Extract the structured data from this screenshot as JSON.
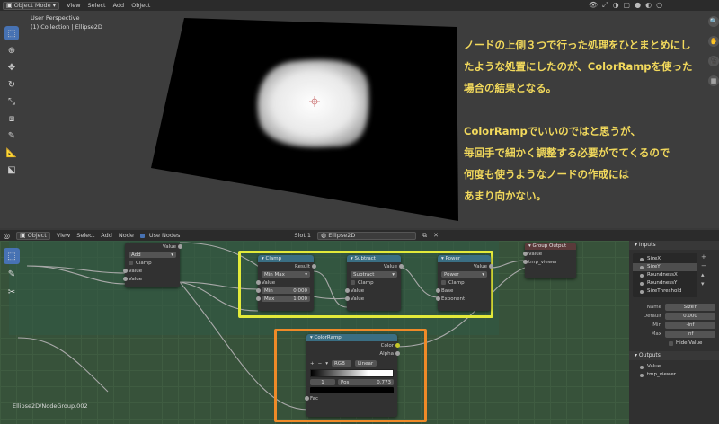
{
  "viewport": {
    "mode": "Object Mode",
    "menu": [
      "View",
      "Select",
      "Add",
      "Object"
    ],
    "perspective": "User Perspective",
    "collection": "(1) Collection | Ellipse2D"
  },
  "annotation": {
    "lines_top": [
      "ノードの上側３つで行った処理をひとまとめにし",
      "たような処置にしたのが、ColorRampを使った",
      "場合の結果となる。"
    ],
    "lines_bottom": [
      "ColorRampでいいのではと思うが、",
      "毎回手で細かく調整する必要がでてくるので",
      "何度も使うようなノードの作成には",
      "あまり向かない。"
    ]
  },
  "node_editor": {
    "type": "Object",
    "menu": [
      "View",
      "Select",
      "Add",
      "Node"
    ],
    "use_nodes": "Use Nodes",
    "slot": "Slot 1",
    "material": "Ellipse2D",
    "breadcrumb": "Ellipse2D/NodeGroup.002",
    "colors": {
      "highlight_yellow": "#e3ea3a",
      "highlight_orange": "#ef8a28",
      "node_header": "#3a6e83"
    }
  },
  "nodes": {
    "math_add": {
      "top_label": "Value",
      "op": "Add",
      "clamp": "Clamp",
      "in1": "Value",
      "in2": "Value"
    },
    "clamp": {
      "title": "Clamp",
      "out": "Result",
      "type": "Min Max",
      "value": "Value",
      "min_label": "Min",
      "min": "0.000",
      "max_label": "Max",
      "max": "1.000"
    },
    "subtract": {
      "title": "Subtract",
      "out": "Value",
      "op": "Subtract",
      "clamp": "Clamp",
      "in1": "Value",
      "in2": "Value"
    },
    "power": {
      "title": "Power",
      "out": "Value",
      "op": "Power",
      "clamp": "Clamp",
      "in1": "Base",
      "in2": "Exponent"
    },
    "group_output": {
      "title": "Group Output",
      "in1": "Value",
      "in2": "tmp_viewer"
    },
    "colorramp": {
      "title": "ColorRamp",
      "out1": "Color",
      "out2": "Alpha",
      "mode": "RGB",
      "interp": "Linear",
      "index": "1",
      "pos_label": "Pos",
      "pos": "0.773",
      "in": "Fac"
    }
  },
  "sidebar": {
    "inputs_title": "Inputs",
    "inputs": [
      "SizeX",
      "SizeY",
      "RoundnessX",
      "RoundnessY",
      "SizeThreshold"
    ],
    "selected_input": "SizeY",
    "name_label": "Name",
    "name_value": "SizeY",
    "default_label": "Default",
    "default_value": "0.000",
    "min_label": "Min",
    "min_value": "-inf",
    "max_label": "Max",
    "max_value": "inf",
    "hide_value": "Hide Value",
    "outputs_title": "Outputs",
    "outputs": [
      "Value",
      "tmp_viewer"
    ]
  }
}
